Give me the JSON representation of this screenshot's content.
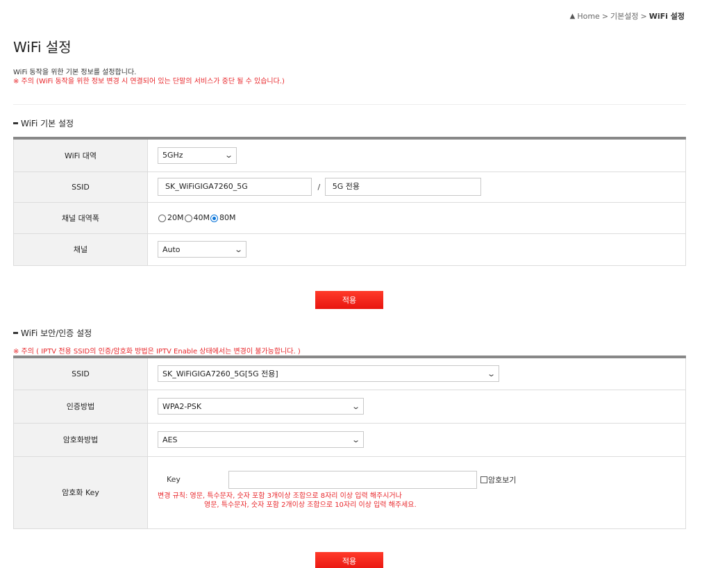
{
  "breadcrumb": {
    "home": "Home",
    "sep1": ">",
    "section": "기본설정",
    "sep2": ">",
    "current": "WiFi 설정"
  },
  "page": {
    "title": "WiFi 설정",
    "description": "WiFi 동작을 위한 기본 정보를 설정합니다.",
    "warning": "※ 주의 (WiFi 동작을 위한 정보 변경 시 연결되어 있는 단말의 서비스가 중단 될 수 있습니다.)"
  },
  "basic": {
    "title": "WiFi 기본 설정",
    "band_label": "WiFi 대역",
    "band_value": "5GHz",
    "ssid_label": "SSID",
    "ssid_value": "SK_WiFiGIGA7260_5G",
    "ssid_sep": "/",
    "ssid_desc_value": "5G 전용",
    "bandwidth_label": "채널 대역폭",
    "bandwidth_options": [
      "20M",
      "40M",
      "80M"
    ],
    "bandwidth_selected": "80M",
    "channel_label": "채널",
    "channel_value": "Auto",
    "apply_label": "적용"
  },
  "security": {
    "title": "WiFi 보안/인증 설정",
    "warning": "※ 주의 ( IPTV 전용 SSID의 인증/암호화 방법은 IPTV Enable 상태에서는 변경이 불가능합니다. )",
    "ssid_label": "SSID",
    "ssid_value": "SK_WiFiGIGA7260_5G[5G 전용]",
    "auth_label": "인증방법",
    "auth_value": "WPA2-PSK",
    "enc_label": "암호화방법",
    "enc_value": "AES",
    "key_row_label": "암호화 Key",
    "key_label": "Key",
    "key_value": "",
    "show_password_label": "암호보기",
    "rule_line1": "변경 규칙: 영문, 특수문자, 숫자 포함 3개이상 조합으로 8자리 이상 입력 해주시거나",
    "rule_line2": "영문, 특수문자, 숫자 포함 2개이상 조합으로 10자리 이상 입력 해주세요.",
    "apply_label": "적용"
  },
  "colors": {
    "accent_red": "#e8262a",
    "radio_blue": "#0a74d8",
    "header_bar": "#888888"
  }
}
